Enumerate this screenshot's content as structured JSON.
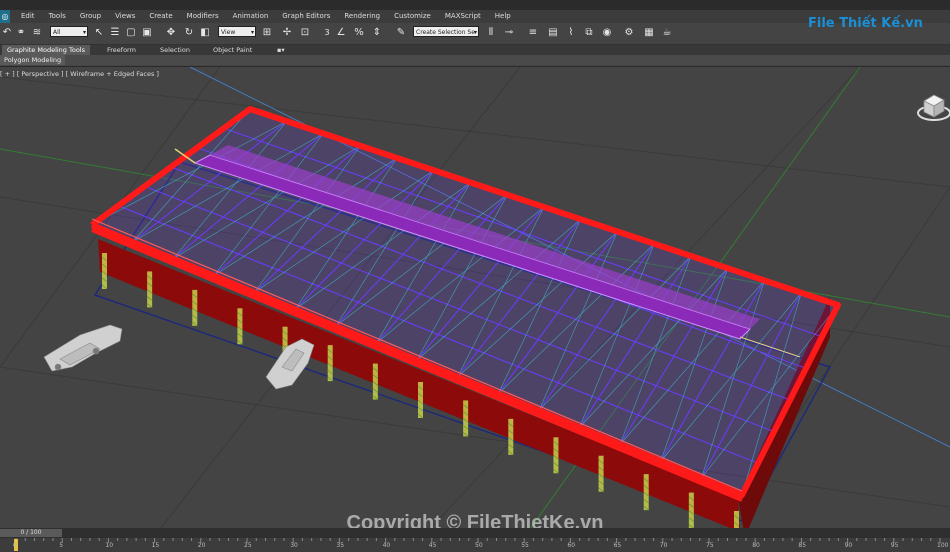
{
  "menu": {
    "items": [
      "Edit",
      "Tools",
      "Group",
      "Views",
      "Create",
      "Modifiers",
      "Animation",
      "Graph Editors",
      "Rendering",
      "Customize",
      "MAXScript",
      "Help"
    ]
  },
  "toolbar": {
    "filter_select": "All",
    "view_select": "View",
    "selection_set": "Create Selection Se",
    "snap_number": "3"
  },
  "ribbon": {
    "tabs": [
      "Graphite Modeling Tools",
      "Freeform",
      "Selection",
      "Object Paint"
    ],
    "panel_label": "Polygon Modeling"
  },
  "viewport": {
    "label": "[ + ] [ Perspective ] [ Wireframe + Edged Faces ]"
  },
  "timeline": {
    "frame_readout": "0 / 100",
    "ticks": [
      "0",
      "5",
      "10",
      "15",
      "20",
      "25",
      "30",
      "35",
      "40",
      "45",
      "50",
      "55",
      "60",
      "65",
      "70",
      "75",
      "80",
      "85",
      "90",
      "95",
      "100"
    ]
  },
  "branding": {
    "logo_text": "File Thiết Kế.vn",
    "watermark": "Copyright © FileThietKe.vn"
  },
  "colors": {
    "viewport_bg": "#444444",
    "roof_edge": "#ff1a1a",
    "wall": "#8c0a0a",
    "truss": "#6a3cff",
    "ridge": "#8b2ab8",
    "brand": "#1a8fd6"
  }
}
